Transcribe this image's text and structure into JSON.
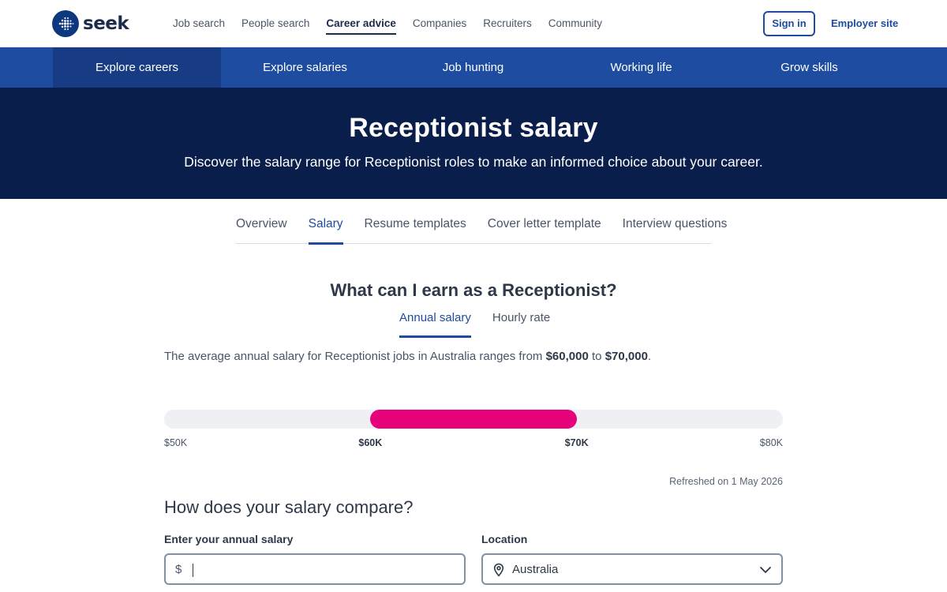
{
  "header": {
    "logo_text": "seek",
    "nav": [
      "Job search",
      "People search",
      "Career advice",
      "Companies",
      "Recruiters",
      "Community"
    ],
    "active_nav": "Career advice",
    "sign_in": "Sign in",
    "employer_site": "Employer site"
  },
  "subnav": {
    "items": [
      "Explore careers",
      "Explore salaries",
      "Job hunting",
      "Working life",
      "Grow skills"
    ],
    "active": "Explore careers"
  },
  "hero": {
    "title": "Receptionist salary",
    "subtitle": "Discover the salary range for Receptionist roles to make an informed choice about your career."
  },
  "tabs": {
    "items": [
      "Overview",
      "Salary",
      "Resume templates",
      "Cover letter template",
      "Interview questions"
    ],
    "active": "Salary"
  },
  "salary_section": {
    "title": "What can I earn as a Receptionist?",
    "rate_options": [
      "Annual salary",
      "Hourly rate"
    ],
    "active_rate": "Annual salary",
    "summary_prefix": "The average annual salary for Receptionist jobs in Australia ranges from ",
    "summary_low": "$60,000",
    "summary_mid": " to ",
    "summary_high": "$70,000",
    "summary_suffix": ".",
    "range": {
      "axis_min": 50000,
      "axis_max": 80000,
      "low": 60000,
      "high": 70000,
      "ticks": [
        {
          "label": "$50K",
          "value": 50000,
          "bold": false
        },
        {
          "label": "$60K",
          "value": 60000,
          "bold": true
        },
        {
          "label": "$70K",
          "value": 70000,
          "bold": true
        },
        {
          "label": "$80K",
          "value": 80000,
          "bold": false
        }
      ],
      "fill_color": "#e60278"
    },
    "refreshed": "Refreshed on 1 May 2026"
  },
  "compare": {
    "title": "How does your salary compare?",
    "salary_label": "Enter your annual salary",
    "salary_prefix": "$",
    "salary_value": "",
    "location_label": "Location",
    "location_value": "Australia"
  },
  "colors": {
    "brand_blue": "#1d4ca0",
    "hero_navy": "#0a1e4b",
    "accent_pink": "#e60278"
  }
}
